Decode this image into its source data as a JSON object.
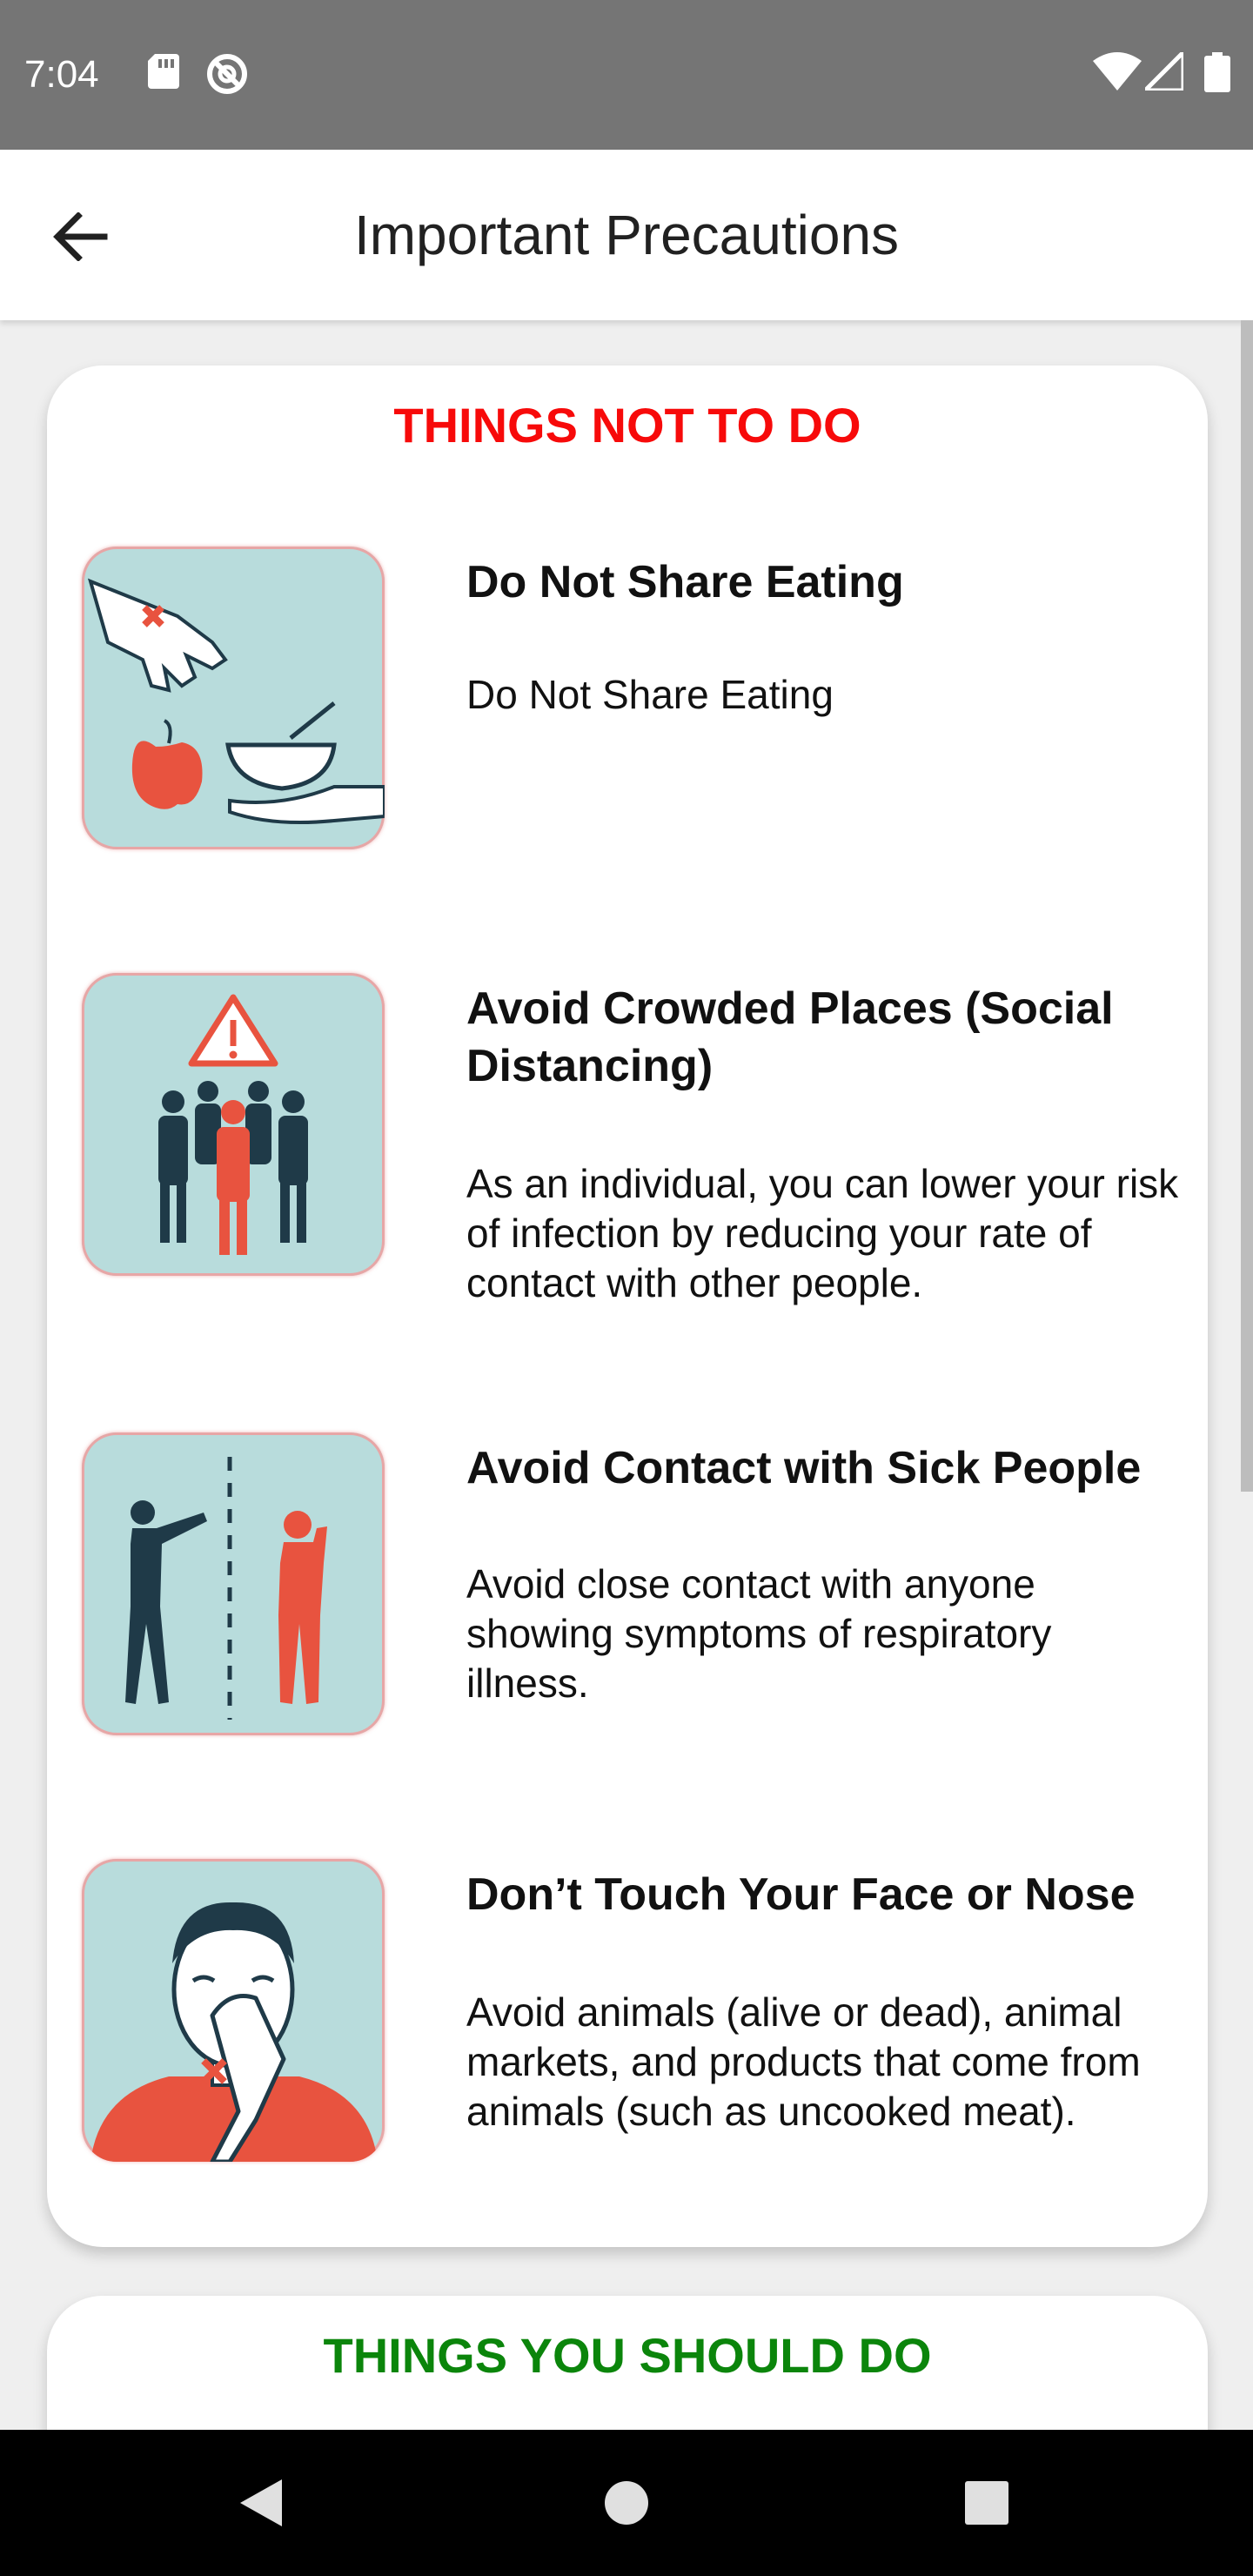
{
  "status_bar": {
    "time": "7:04"
  },
  "app_bar": {
    "title": "Important Precautions"
  },
  "sections": [
    {
      "title": "THINGS NOT TO DO",
      "title_color": "#f70a0a",
      "items": [
        {
          "title": "Do Not Share Eating",
          "description": "Do Not Share Eating",
          "icon": "no-sharing-food-icon"
        },
        {
          "title": "Avoid Crowded Places (Social Distancing)",
          "description": "As an individual, you can lower your risk of infection by reducing your rate of contact with other people.",
          "icon": "crowd-warning-icon"
        },
        {
          "title": "Avoid Contact with Sick People",
          "description": "Avoid close contact with anyone showing symptoms of respiratory illness.",
          "icon": "distance-sick-person-icon"
        },
        {
          "title": "Don’t Touch Your Face or Nose",
          "description": "Avoid animals (alive or dead), animal markets, and products that come from animals (such as uncooked meat).",
          "icon": "no-face-touch-icon"
        }
      ]
    },
    {
      "title": "THINGS YOU SHOULD DO",
      "title_color": "#0b850b"
    }
  ],
  "colors": {
    "accent_red": "#e8533f",
    "icon_bg": "#b8dcdc",
    "figure_dark": "#1f3a48"
  }
}
